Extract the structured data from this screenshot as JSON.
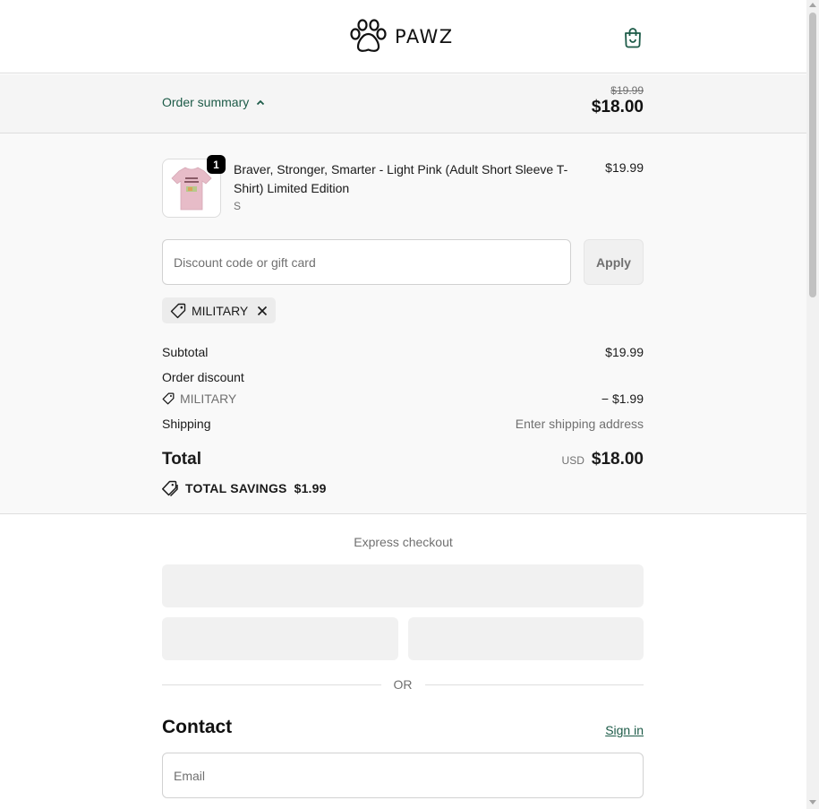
{
  "header": {
    "brand": "PAWZ",
    "logo_icon": "paw-print-icon",
    "cart_icon": "shopping-bag-icon"
  },
  "summary_bar": {
    "toggle_label": "Order summary",
    "original_price": "$19.99",
    "current_price": "$18.00"
  },
  "line_item": {
    "quantity": "1",
    "name": "Braver, Stronger, Smarter - Light Pink (Adult Short Sleeve T-Shirt) Limited Edition",
    "variant": "S",
    "price": "$19.99"
  },
  "discount": {
    "placeholder": "Discount code or gift card",
    "apply_label": "Apply",
    "applied_code": "MILITARY"
  },
  "totals": {
    "subtotal_label": "Subtotal",
    "subtotal_value": "$19.99",
    "order_discount_label": "Order discount",
    "discount_code": "MILITARY",
    "discount_value": "− $1.99",
    "shipping_label": "Shipping",
    "shipping_value": "Enter shipping address",
    "total_label": "Total",
    "currency": "USD",
    "total_value": "$18.00",
    "savings_label": "TOTAL SAVINGS",
    "savings_value": "$1.99"
  },
  "express": {
    "title": "Express checkout",
    "or_label": "OR"
  },
  "contact": {
    "title": "Contact",
    "signin_label": "Sign in",
    "email_placeholder": "Email"
  },
  "colors": {
    "accent": "#1d5b48",
    "summary_bg": "#f5f5f5",
    "muted_text": "#707070"
  }
}
